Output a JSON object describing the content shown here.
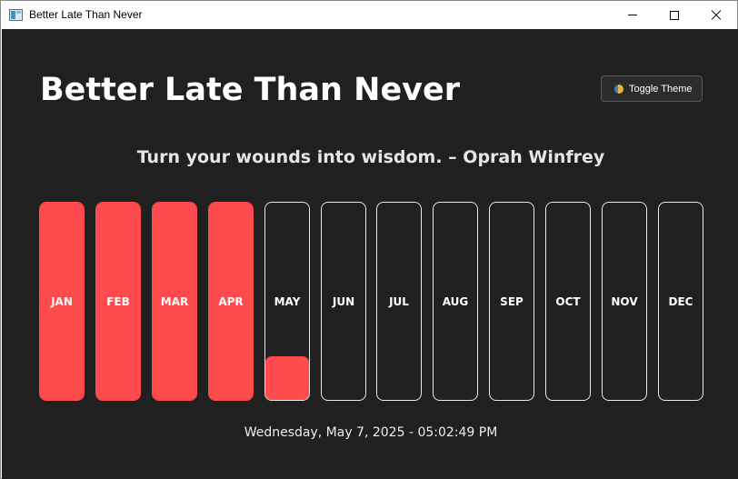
{
  "window": {
    "title": "Better Late Than Never",
    "controls": [
      "minimize-icon",
      "maximize-icon",
      "close-icon"
    ]
  },
  "header": {
    "title": "Better Late Than Never",
    "theme_button_label": "Toggle Theme",
    "theme_button_icon": "half-moon-icon"
  },
  "quote": "Turn your wounds into wisdom. – Oprah Winfrey",
  "months": [
    {
      "label": "JAN",
      "progress": 1.0
    },
    {
      "label": "FEB",
      "progress": 1.0
    },
    {
      "label": "MAR",
      "progress": 1.0
    },
    {
      "label": "APR",
      "progress": 1.0
    },
    {
      "label": "MAY",
      "progress": 0.22
    },
    {
      "label": "JUN",
      "progress": 0
    },
    {
      "label": "JUL",
      "progress": 0
    },
    {
      "label": "AUG",
      "progress": 0
    },
    {
      "label": "SEP",
      "progress": 0
    },
    {
      "label": "OCT",
      "progress": 0
    },
    {
      "label": "NOV",
      "progress": 0
    },
    {
      "label": "DEC",
      "progress": 0
    }
  ],
  "datetime": "Wednesday, May 7, 2025 - 05:02:49 PM",
  "colors": {
    "background": "#202020",
    "accent": "#ff4a4e",
    "text": "#ffffff",
    "border": "#e8e8e8"
  }
}
